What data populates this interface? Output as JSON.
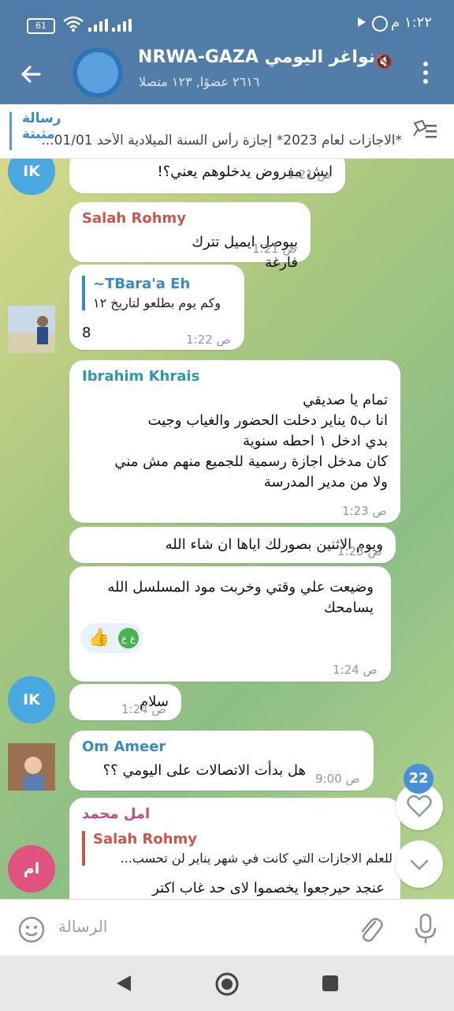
{
  "status_bar": {
    "time": "١:٢٢ م",
    "battery": "61"
  },
  "header": {
    "title": "نواغر اليومي UNRWA-GAZA",
    "subtitle": "٢٦١٦ عضوًا, ١٢٣ متصلا"
  },
  "pinned": {
    "label": "رسالة مثبتة",
    "text": "*الاجازات لعام 2023* إجازة رأس السنة الميلادية الأحد 01/01..."
  },
  "messages": [
    {
      "avatar_initials": "IK",
      "text": "ايش مفروض يدخلوهم يعني؟!",
      "time": "1:21 ص"
    },
    {
      "sender": "Salah Rohmy",
      "text": "بيوصل ايميل تترك فارغة",
      "time": "1:21 ص"
    },
    {
      "reply_name": "~TBara'a Eh",
      "reply_text": "وكم يوم بطلعو لتاريخ ١٢",
      "text": "8",
      "time": "1:22 ص"
    },
    {
      "sender": "Ibrahim Khrais",
      "lines": [
        "تمام يا صديقي",
        "انا ب٥ يناير دخلت الحضور والغياب وجيت",
        "بدي ادخل ١ احطه سنوية",
        "كان مدخل اجازة رسمية للجميع منهم مش مني",
        "ولا من مدير المدرسة"
      ],
      "time": "1:23 ص"
    },
    {
      "text": "ويوم الاثنين بصورلك اياها ان شاء الله",
      "time": "1:23 ص"
    },
    {
      "lines": [
        "وضيعت علي وقتي وخربت مود المسلسل الله",
        "يسامحك"
      ],
      "reaction_label": "ع ع",
      "time": "1:24 ص"
    },
    {
      "avatar_initials": "IK",
      "text": "سلام",
      "time": "1:24 ص"
    },
    {
      "sender": "Om Ameer",
      "text": "هل بدأت الاتصالات على اليومي ؟؟",
      "time": "9:00 ص"
    },
    {
      "avatar_initials": "ام",
      "sender": "امل محمد",
      "reply_name": "Salah Rohmy",
      "reply_text": "للعلم الاجازات التي كانت في شهر يناير لن تحسب...",
      "text": "عنجد حيرجعوا  يخصموا لاى حد غاب اكتر"
    }
  ],
  "unread_count": "22",
  "composer": {
    "placeholder": "الرسالة"
  },
  "colors": {
    "header": "#527da8",
    "accent": "#3a8ac6",
    "name_salah": "#c8574e",
    "name_ibrahim": "#2f9aa6",
    "name_om": "#3a8ac6",
    "name_amal": "#c04a8a"
  }
}
